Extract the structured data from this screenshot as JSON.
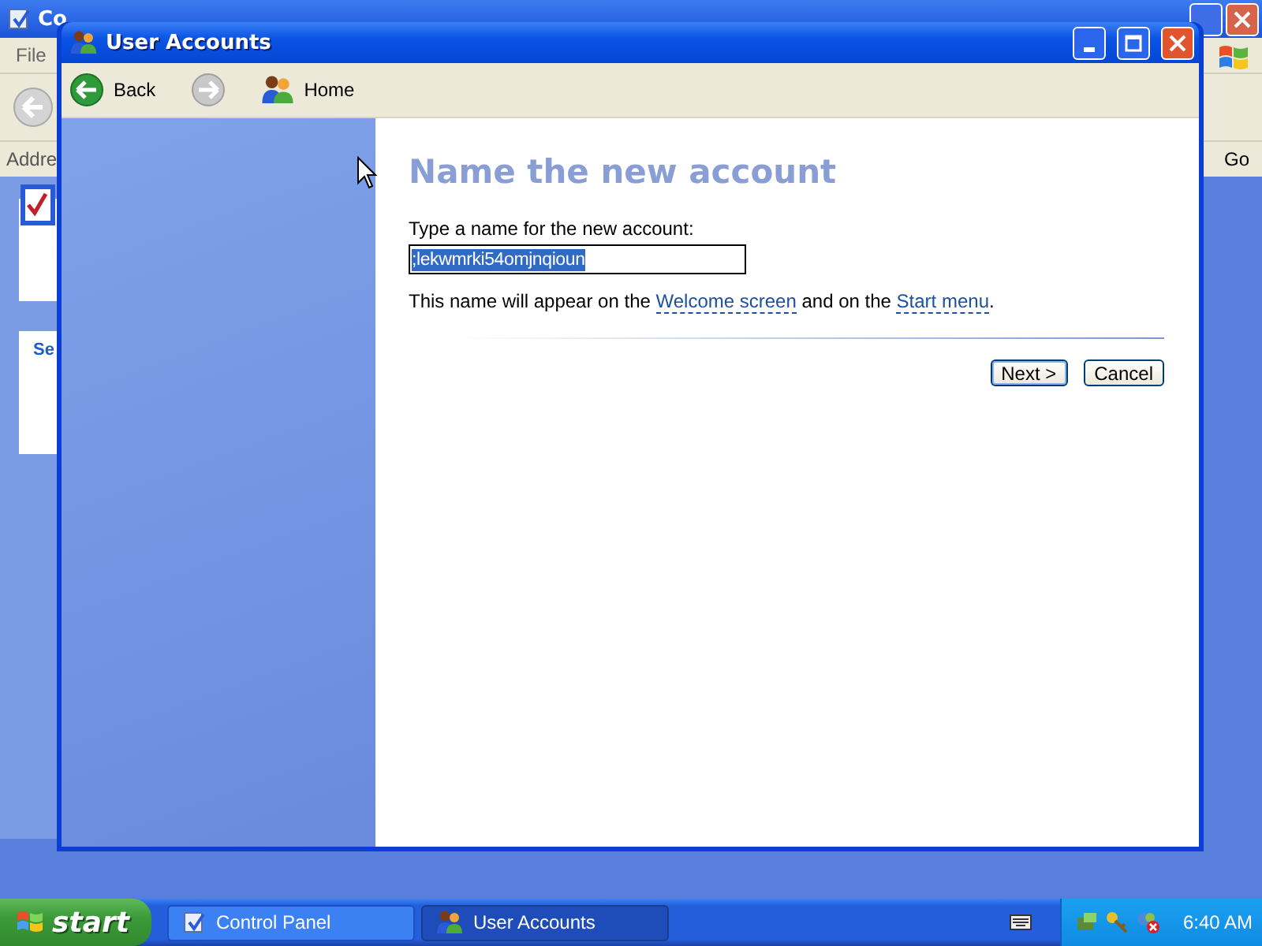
{
  "background_window": {
    "title": "Co",
    "menu": [
      "File"
    ],
    "address_label": "Addre",
    "go_button": "Go",
    "panel_heading": "Se"
  },
  "window": {
    "title": "User Accounts"
  },
  "toolbar": [
    {
      "kind": "back",
      "label": "Back",
      "disabled": false
    },
    {
      "kind": "forward",
      "disabled": true
    },
    {
      "kind": "home",
      "label": "Home",
      "disabled": false
    }
  ],
  "page": {
    "heading": "Name the new account",
    "prompt": "Type a name for the new account:",
    "name_field": {
      "value": ";lekwmrki54omjnqioun",
      "text_selected": true
    },
    "hint": [
      {
        "kind": "text",
        "text": "This name will appear on the "
      },
      {
        "kind": "link",
        "text": "Welcome screen"
      },
      {
        "kind": "text",
        "text": " and on the "
      },
      {
        "kind": "link",
        "text": "Start menu"
      },
      {
        "kind": "text",
        "text": "."
      }
    ],
    "buttons": [
      {
        "label": "Next >",
        "default": true
      },
      {
        "label": "Cancel",
        "default": false
      }
    ]
  },
  "taskbar": {
    "start": "start",
    "tasks": [
      {
        "label": "Control Panel",
        "kind": "control-panel",
        "selected": false
      },
      {
        "label": "User Accounts",
        "kind": "users",
        "selected": true
      }
    ],
    "clock": "6:40 AM"
  }
}
